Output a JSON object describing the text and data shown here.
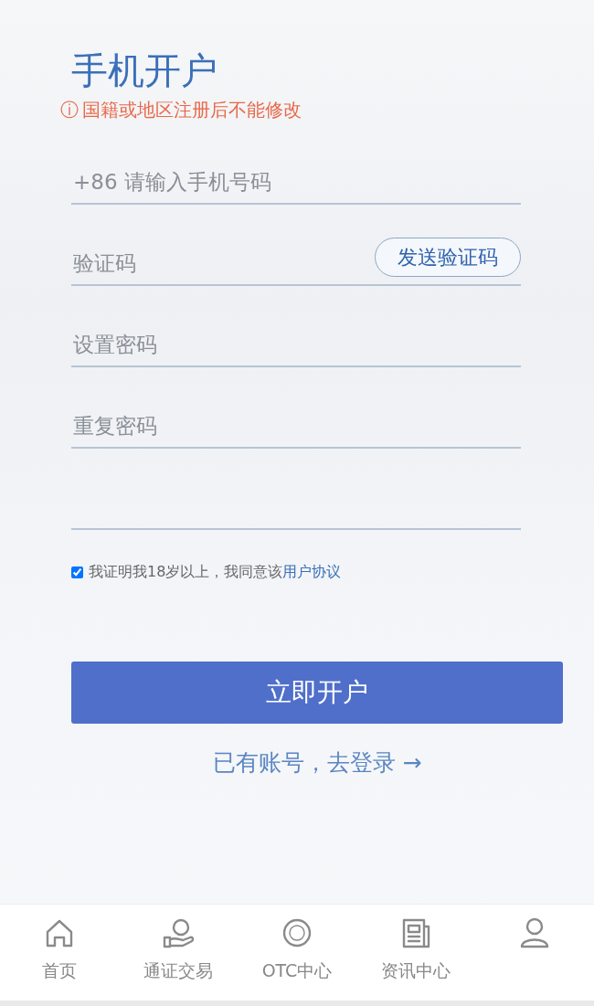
{
  "title": "手机开户",
  "notice": {
    "icon": "ⓘ",
    "text": "国籍或地区注册后不能修改"
  },
  "fields": [
    {
      "kind": "input",
      "placeholder": "+86 请输入手机号码"
    },
    {
      "kind": "code",
      "placeholder": "验证码",
      "button": "发送验证码"
    },
    {
      "kind": "input",
      "placeholder": "设置密码"
    },
    {
      "kind": "input",
      "placeholder": "重复密码"
    },
    {
      "kind": "input"
    }
  ],
  "agreement": {
    "checked": true,
    "text": "我证明我18岁以上，我同意该",
    "link": "用户协议"
  },
  "submit": "立即开户",
  "login_link": "已有账号，去登录 →",
  "tabbar": [
    {
      "kind": "home",
      "label": "首页"
    },
    {
      "kind": "exchange",
      "label": "通证交易"
    },
    {
      "kind": "otc",
      "label": "OTC中心"
    },
    {
      "kind": "news",
      "label": "资讯中心"
    },
    {
      "kind": "user"
    }
  ]
}
